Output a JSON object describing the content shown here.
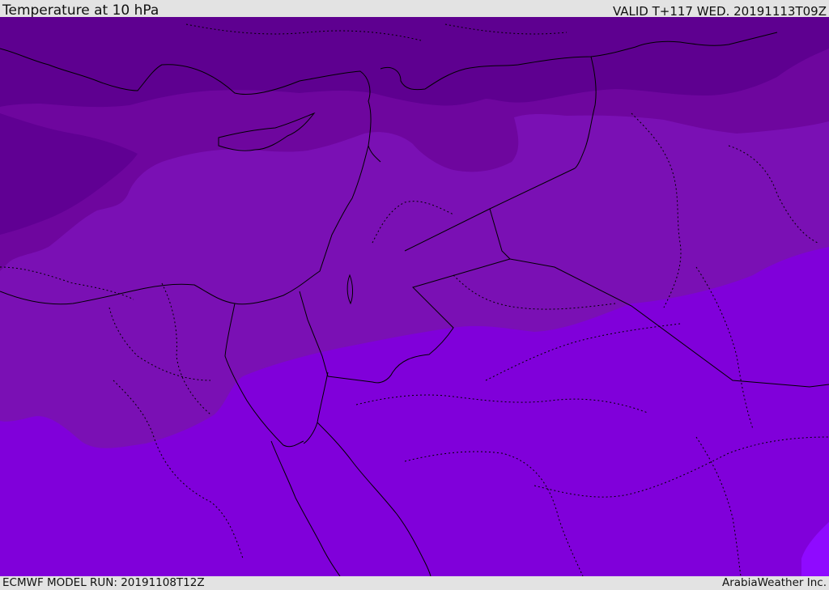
{
  "header": {
    "title": "Temperature at 10 hPa",
    "valid": "VALID T+117 WED. 20191113T09Z"
  },
  "footer": {
    "model_run": "ECMWF MODEL RUN: 20191108T12Z",
    "credit": "ArabiaWeather Inc."
  },
  "map": {
    "variable": "temperature",
    "level": "10 hPa",
    "colors": {
      "band_coldest": "#5e0090",
      "band_cold": "#6e069e",
      "band_mid": "#7a10b4",
      "band_warm": "#8000da",
      "band_warmest": "#8f0aff",
      "coastline": "#000000",
      "border_dotted": "#000000"
    }
  }
}
